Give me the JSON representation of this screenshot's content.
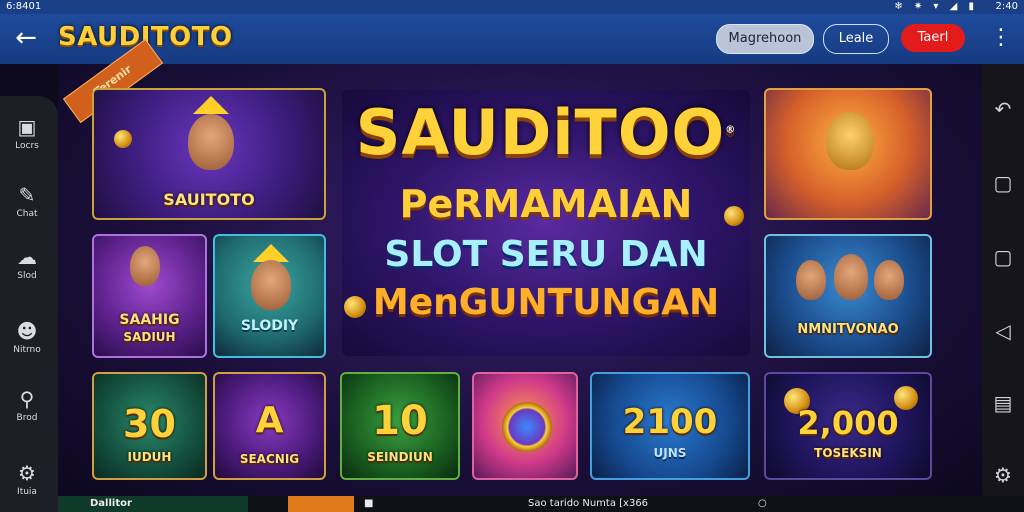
{
  "status": {
    "time": "6:8401",
    "clock": "2:40",
    "icons": "❄ ✷ ▾ ◢ ▮"
  },
  "header": {
    "brand": "SAUDITOTO",
    "login_label": "Magrehoon",
    "list_label": "Leale",
    "daftar_label": "Taerl"
  },
  "left_rail": [
    {
      "label": "Locrs"
    },
    {
      "label": "Chat"
    },
    {
      "label": "Slod"
    },
    {
      "label": "Nitrno"
    },
    {
      "label": "Brod"
    },
    {
      "label": "Ituia"
    }
  ],
  "ribbon": "Terenir",
  "hero": {
    "title": "SAUDiTOO",
    "trademark": "®",
    "line1": "PeRMAMAIAN",
    "line2": "SLOT SERU DAN",
    "line3": "MenGUNTUNGAN"
  },
  "tiles": {
    "t_sauditoto": "SAUITOTO",
    "t_saahig": "SAAHIG",
    "t_saahig2": "SADIUH",
    "t_slodiy": "SLODIY",
    "t_nimi": "NMNITVONAO",
    "t_30": "30",
    "t_30_sub": "IUDUH",
    "t_a": "A",
    "t_a_sub": "SEACNIG",
    "t_10": "10",
    "t_10_sub": "SEINDIUN",
    "t_2100": "2100",
    "t_2100_sub": "UJNS",
    "t_2000": "2,000",
    "t_2000_sub": "TOSEKSIN"
  },
  "bottom": {
    "item1": "Dallitor",
    "item2": "Sao tarido Numta [x366"
  },
  "colors": {
    "header": "#1f4b9c",
    "accent_gold": "#ffd23a",
    "danger": "#e31b1b"
  }
}
